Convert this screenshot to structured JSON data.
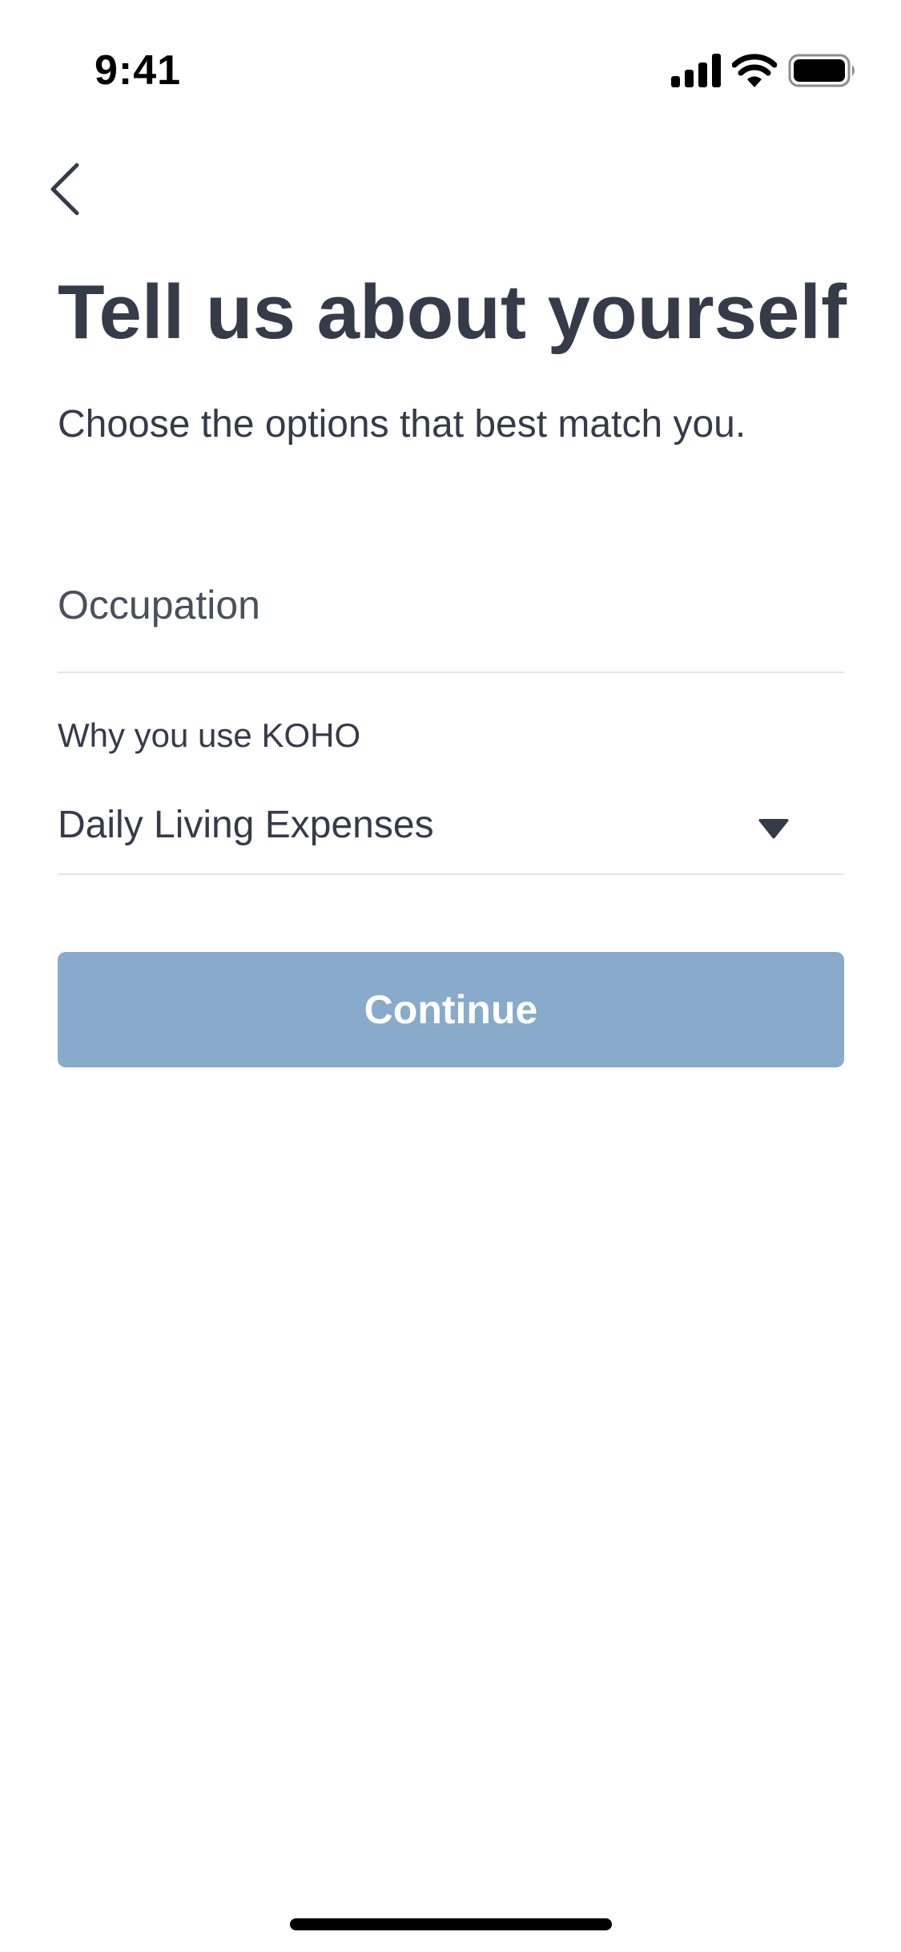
{
  "status_bar": {
    "time": "9:41",
    "icons": [
      "cellular-signal-icon",
      "wifi-icon",
      "battery-icon"
    ]
  },
  "navigation": {
    "back_icon": "chevron-left-icon"
  },
  "header": {
    "title": "Tell us about yourself",
    "subtitle": "Choose the options that best match you."
  },
  "form": {
    "occupation": {
      "placeholder": "Occupation",
      "value": ""
    },
    "reason": {
      "label": "Why you use KOHO",
      "selected": "Daily Living Expenses",
      "icon": "caret-down-icon"
    }
  },
  "actions": {
    "continue_label": "Continue"
  },
  "colors": {
    "text_primary": "#363b4a",
    "button_background": "#88aacb",
    "button_text": "#ffffff",
    "divider": "#e3e4e8"
  }
}
